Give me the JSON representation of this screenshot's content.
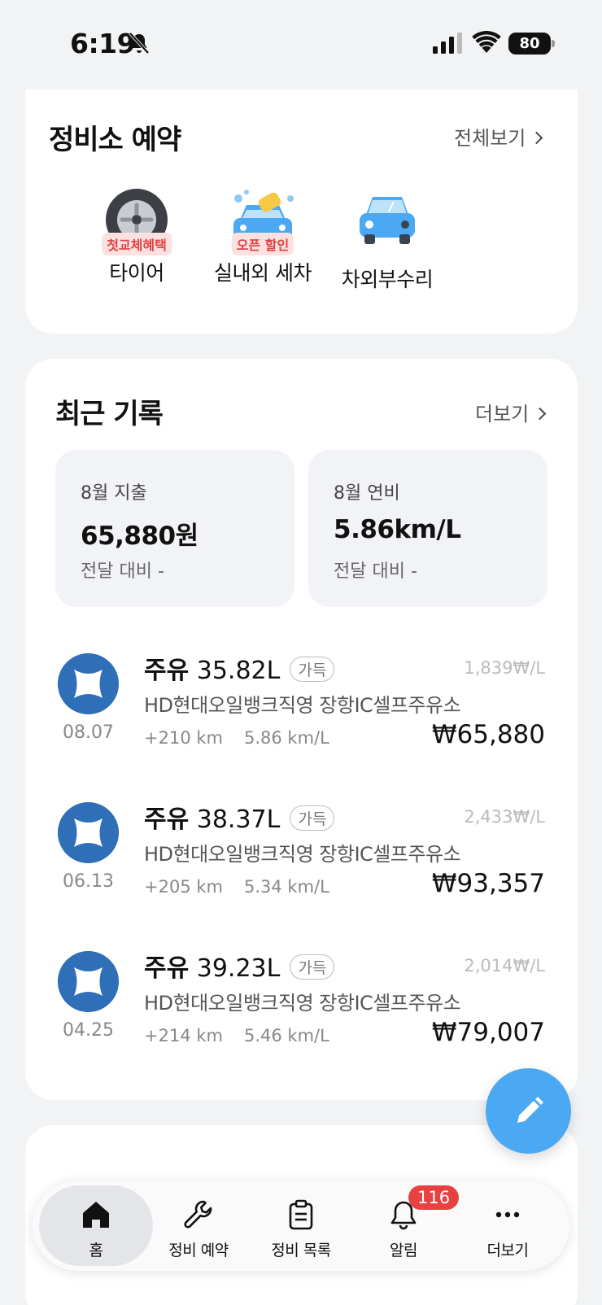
{
  "status_bar": {
    "time": "6:19",
    "battery": "80"
  },
  "service_booking": {
    "title": "정비소 예약",
    "view_all": "전체보기",
    "items": [
      {
        "label": "타이어",
        "badge": "첫교체혜택",
        "icon": "tire-icon"
      },
      {
        "label": "실내외 세차",
        "badge": "오픈 할인",
        "icon": "car-wash-icon"
      },
      {
        "label": "차외부수리",
        "badge": "",
        "icon": "car-icon"
      }
    ]
  },
  "recent": {
    "title": "최근 기록",
    "more": "더보기",
    "stats": [
      {
        "label": "8월 지출",
        "value": "65,880원",
        "sub": "전달 대비 -"
      },
      {
        "label": "8월 연비",
        "value": "5.86km/L",
        "sub": "전달 대비 -"
      }
    ],
    "records": [
      {
        "type": "주유",
        "amount_l": "35.82L",
        "tag": "가득",
        "unit_price": "1,839₩/L",
        "station": "HD현대오일뱅크직영 장항IC셀프주유소",
        "distance": "+210 km",
        "efficiency": "5.86 km/L",
        "total": "₩65,880",
        "date": "08.07"
      },
      {
        "type": "주유",
        "amount_l": "38.37L",
        "tag": "가득",
        "unit_price": "2,433₩/L",
        "station": "HD현대오일뱅크직영 장항IC셀프주유소",
        "distance": "+205 km",
        "efficiency": "5.34 km/L",
        "total": "₩93,357",
        "date": "06.13"
      },
      {
        "type": "주유",
        "amount_l": "39.23L",
        "tag": "가득",
        "unit_price": "2,014₩/L",
        "station": "HD현대오일뱅크직영 장항IC셀프주유소",
        "distance": "+214 km",
        "efficiency": "5.46 km/L",
        "total": "₩79,007",
        "date": "04.25"
      }
    ]
  },
  "tab_bar": {
    "tabs": [
      {
        "label": "홈",
        "icon": "home-icon",
        "active": true
      },
      {
        "label": "정비 예약",
        "icon": "wrench-icon"
      },
      {
        "label": "정비 목록",
        "icon": "clipboard-icon"
      },
      {
        "label": "알림",
        "icon": "bell-icon",
        "badge": "116"
      },
      {
        "label": "더보기",
        "icon": "more-icon"
      }
    ]
  },
  "colors": {
    "accent": "#4ba8f2",
    "brand_logo": "#2f6fb7",
    "badge_red": "#e84141"
  }
}
